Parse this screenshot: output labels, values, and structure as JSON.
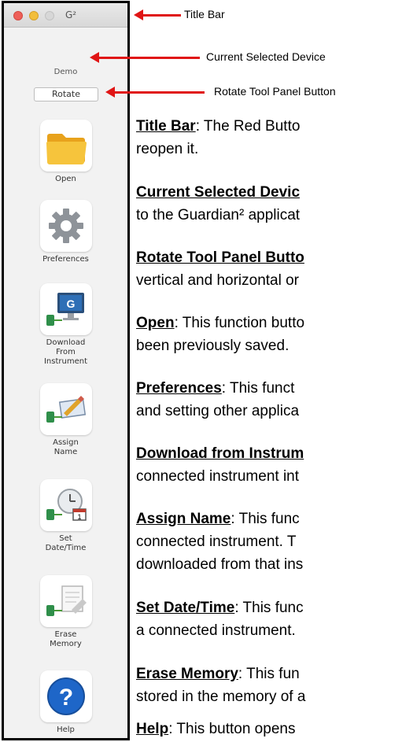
{
  "window": {
    "app_title": "G²",
    "current_device": "Demo",
    "rotate_button": "Rotate",
    "tools": [
      {
        "label": "Open",
        "icon": "folder-icon"
      },
      {
        "label": "Preferences",
        "icon": "gear-icon"
      },
      {
        "label": "Download\nFrom\nInstrument",
        "icon": "download-instrument-icon"
      },
      {
        "label": "Assign\nName",
        "icon": "assign-name-icon"
      },
      {
        "label": "Set\nDate/Time",
        "icon": "set-date-time-icon"
      },
      {
        "label": "Erase\nMemory",
        "icon": "erase-memory-icon"
      },
      {
        "label": "Help",
        "icon": "help-icon"
      }
    ]
  },
  "callouts": {
    "title_bar": "Title Bar",
    "current_device": "Current Selected Device",
    "rotate": "Rotate Tool Panel Button"
  },
  "descriptions": [
    {
      "term": "Title Bar",
      "lines": [
        ":  The Red Butto",
        "reopen it."
      ]
    },
    {
      "term": "Current Selected Devic",
      "lines": [
        "",
        "to the Guardian² applicat"
      ]
    },
    {
      "term": "Rotate Tool Panel Butto",
      "lines": [
        "",
        "vertical and horizontal or"
      ]
    },
    {
      "term": "Open",
      "lines": [
        ": This function butto",
        "been previously saved."
      ]
    },
    {
      "term": "Preferences",
      "lines": [
        ":  This funct",
        "and setting other applica"
      ]
    },
    {
      "term": "Download from Instrum",
      "lines": [
        "",
        "connected instrument int"
      ]
    },
    {
      "term": "Assign Name",
      "lines": [
        ": This func",
        "connected instrument.   T",
        "downloaded from that ins"
      ]
    },
    {
      "term": "Set Date/Time",
      "lines": [
        ": This func",
        "a connected instrument."
      ]
    },
    {
      "term": "Erase Memory",
      "lines": [
        ": This fun",
        "stored in the memory of a"
      ]
    },
    {
      "term": "Help",
      "lines": [
        ": This button opens"
      ]
    }
  ],
  "colors": {
    "arrow": "#e01515",
    "close": "#ee5f58",
    "minimize": "#f2be3c",
    "help_blue": "#1e66c8"
  }
}
